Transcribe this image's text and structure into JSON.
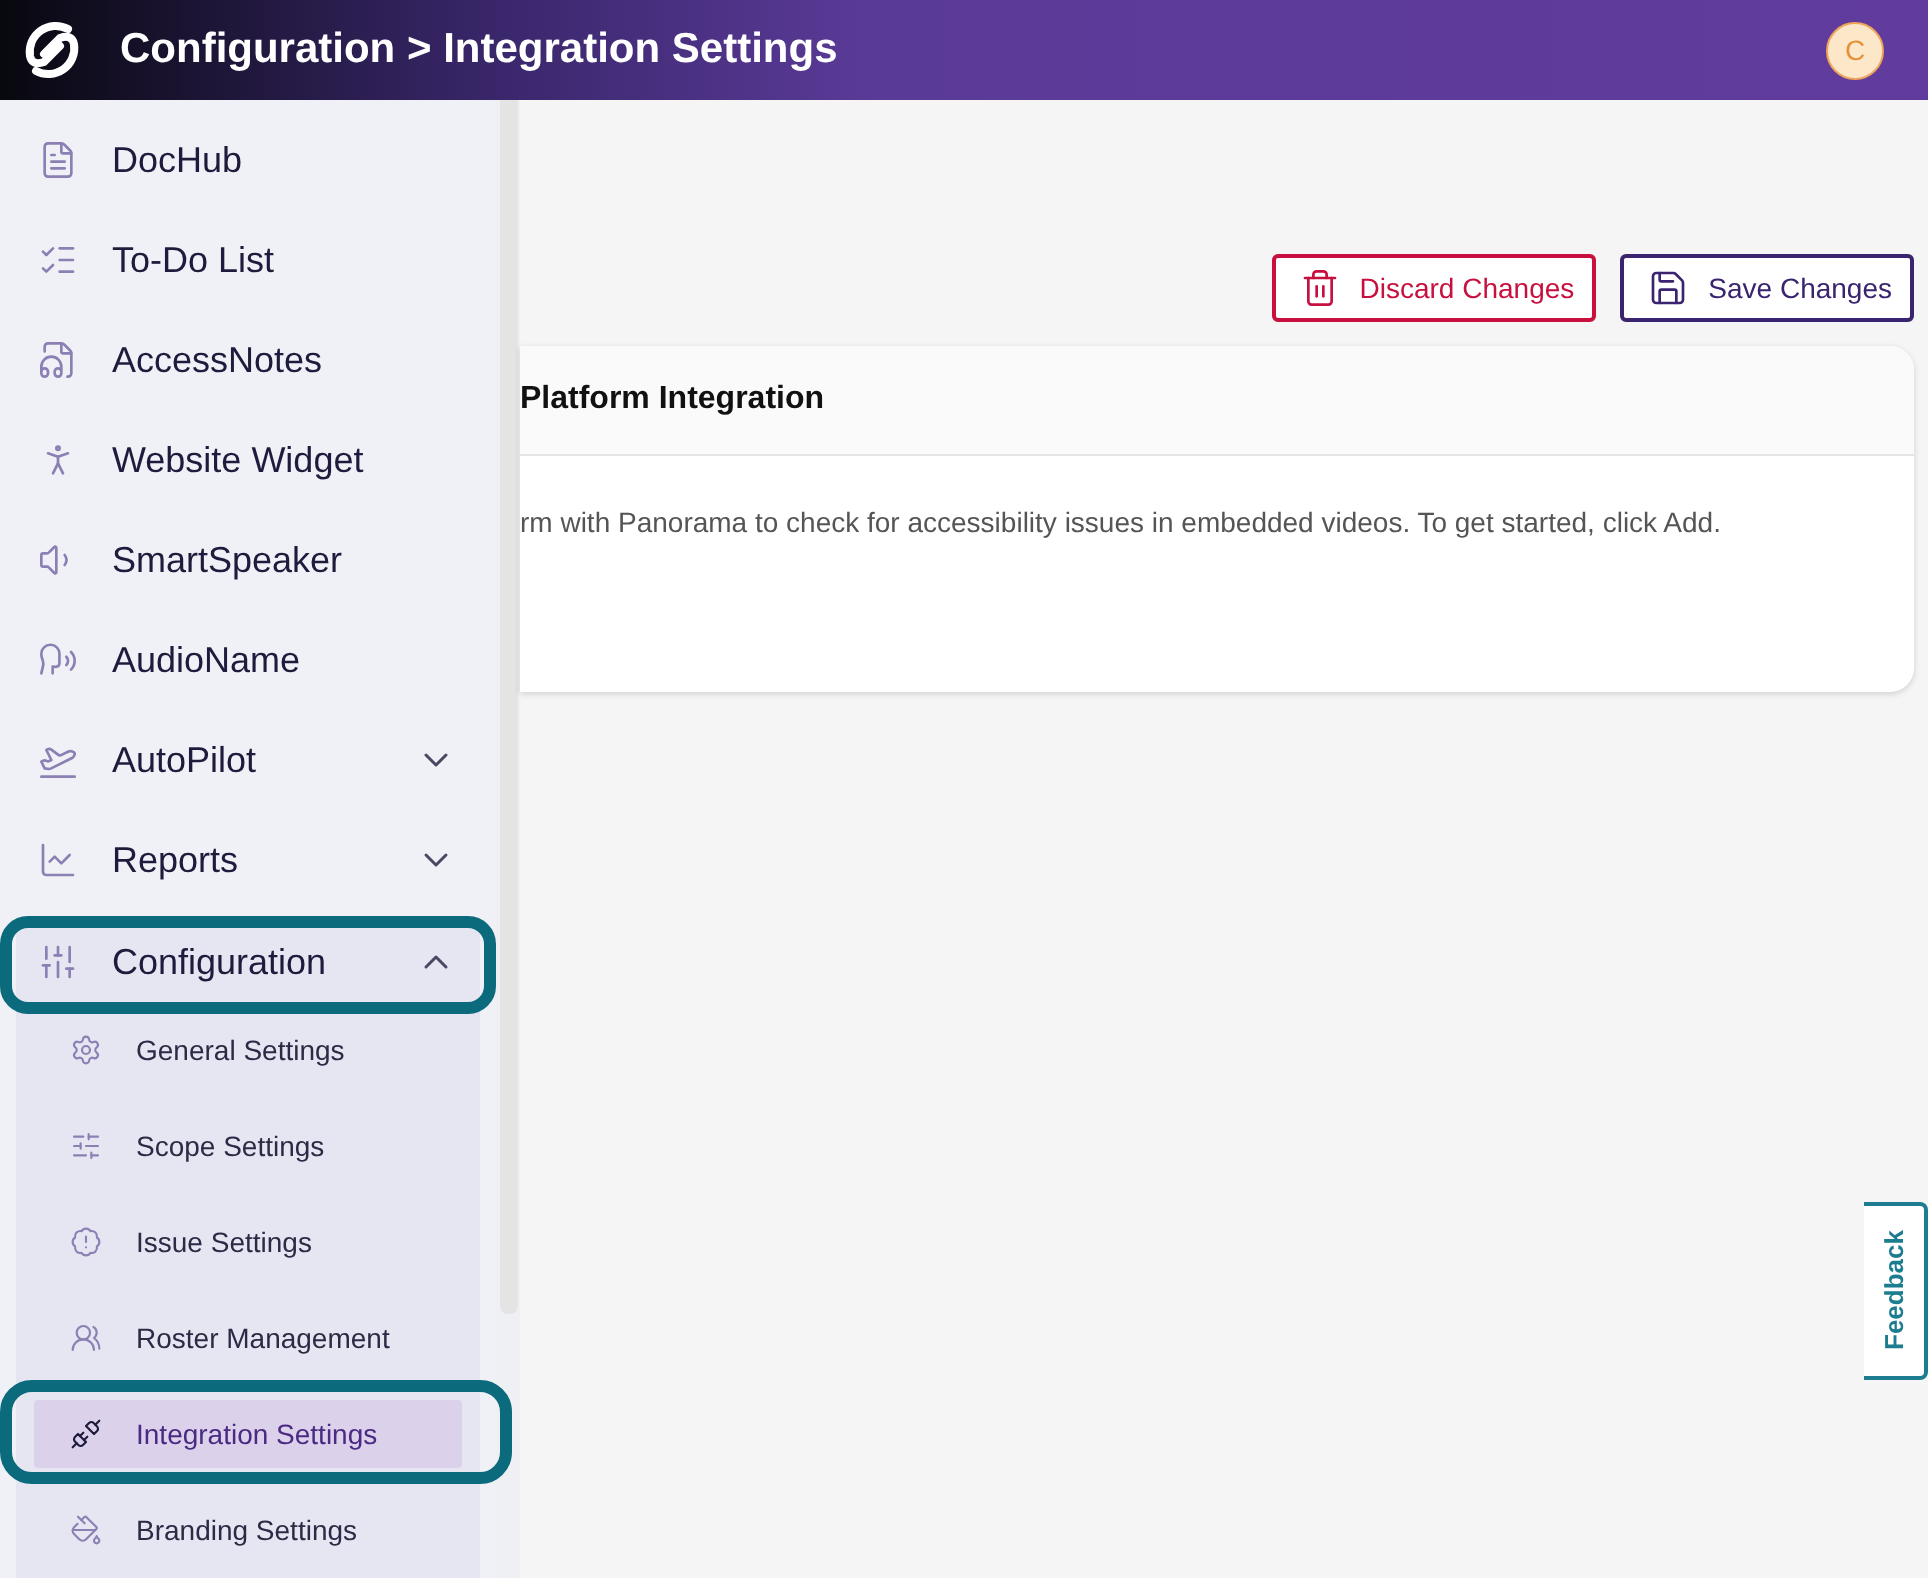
{
  "header": {
    "title": "Configuration > Integration Settings",
    "avatar_initial": "C"
  },
  "sidebar": {
    "items": [
      {
        "label": "DocHub",
        "highlighted": false
      },
      {
        "label": "To-Do List",
        "highlighted": false
      },
      {
        "label": "AccessNotes",
        "highlighted": false
      },
      {
        "label": "Website Widget",
        "highlighted": false
      },
      {
        "label": "SmartSpeaker",
        "highlighted": false
      },
      {
        "label": "AudioName",
        "highlighted": false
      },
      {
        "label": "AutoPilot",
        "expanded": false,
        "highlighted": false
      },
      {
        "label": "Reports",
        "expanded": false,
        "highlighted": false
      },
      {
        "label": "Configuration",
        "expanded": true,
        "highlighted": true,
        "children": [
          {
            "label": "General Settings",
            "selected": false,
            "highlighted": false
          },
          {
            "label": "Scope Settings",
            "selected": false,
            "highlighted": false
          },
          {
            "label": "Issue Settings",
            "selected": false,
            "highlighted": false
          },
          {
            "label": "Roster Management",
            "selected": false,
            "highlighted": false
          },
          {
            "label": "Integration Settings",
            "selected": true,
            "highlighted": true
          },
          {
            "label": "Branding Settings",
            "selected": false,
            "highlighted": false
          }
        ]
      }
    ]
  },
  "actions": [
    {
      "label": "Discard Changes",
      "kind": "discard"
    },
    {
      "label": "Save Changes",
      "kind": "save"
    }
  ],
  "card": {
    "title": "Platform Integration",
    "text": "rm with Panorama to check for accessibility issues in embedded videos. To get started, click Add."
  },
  "feedback": {
    "label": "Feedback"
  }
}
